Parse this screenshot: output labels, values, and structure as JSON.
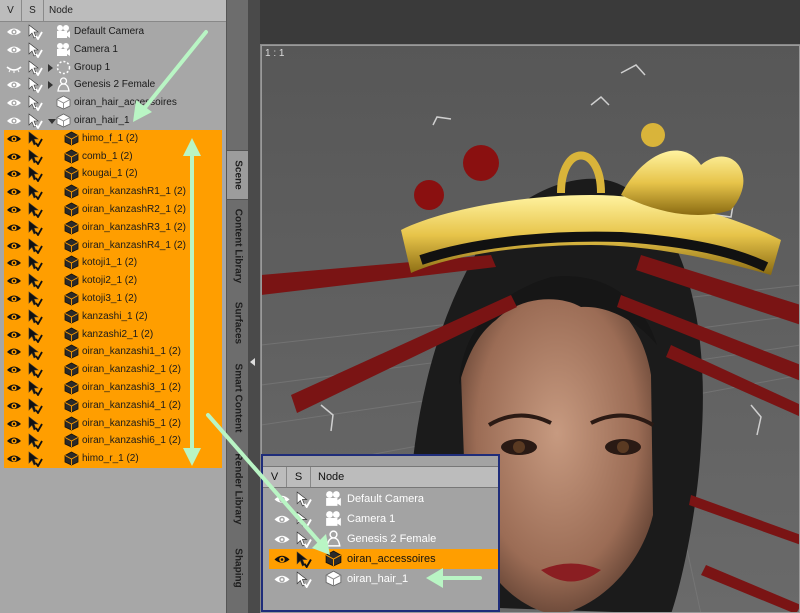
{
  "scene": {
    "columns": {
      "v": "V",
      "s": "S",
      "node": "Node"
    },
    "rows": [
      {
        "label": "Default Camera",
        "icon": "camera-icon",
        "indent": 0,
        "expand": "none",
        "visible": true,
        "selected": false
      },
      {
        "label": "Camera 1",
        "icon": "camera-icon",
        "indent": 0,
        "expand": "none",
        "visible": true,
        "selected": false
      },
      {
        "label": "Group 1",
        "icon": "group-icon",
        "indent": 0,
        "expand": "closed",
        "visible": false,
        "selected": false
      },
      {
        "label": "Genesis 2 Female",
        "icon": "figure-icon",
        "indent": 0,
        "expand": "closed",
        "visible": true,
        "selected": false
      },
      {
        "label": "oiran_hair_accessoires",
        "icon": "prop-icon",
        "indent": 0,
        "expand": "none",
        "visible": true,
        "selected": false
      },
      {
        "label": "oiran_hair_1",
        "icon": "prop-icon",
        "indent": 0,
        "expand": "open",
        "visible": true,
        "selected": false
      },
      {
        "label": "himo_f_1 (2)",
        "icon": "prop-icon",
        "indent": 1,
        "expand": "none",
        "visible": true,
        "selected": true
      },
      {
        "label": "comb_1 (2)",
        "icon": "prop-icon",
        "indent": 1,
        "expand": "none",
        "visible": true,
        "selected": true
      },
      {
        "label": "kougai_1 (2)",
        "icon": "prop-icon",
        "indent": 1,
        "expand": "none",
        "visible": true,
        "selected": true
      },
      {
        "label": "oiran_kanzashR1_1 (2)",
        "icon": "prop-icon",
        "indent": 1,
        "expand": "none",
        "visible": true,
        "selected": true
      },
      {
        "label": "oiran_kanzashR2_1 (2)",
        "icon": "prop-icon",
        "indent": 1,
        "expand": "none",
        "visible": true,
        "selected": true
      },
      {
        "label": "oiran_kanzashR3_1 (2)",
        "icon": "prop-icon",
        "indent": 1,
        "expand": "none",
        "visible": true,
        "selected": true
      },
      {
        "label": "oiran_kanzashR4_1 (2)",
        "icon": "prop-icon",
        "indent": 1,
        "expand": "none",
        "visible": true,
        "selected": true
      },
      {
        "label": "kotoji1_1 (2)",
        "icon": "prop-icon",
        "indent": 1,
        "expand": "none",
        "visible": true,
        "selected": true
      },
      {
        "label": "kotoji2_1 (2)",
        "icon": "prop-icon",
        "indent": 1,
        "expand": "none",
        "visible": true,
        "selected": true
      },
      {
        "label": "kotoji3_1 (2)",
        "icon": "prop-icon",
        "indent": 1,
        "expand": "none",
        "visible": true,
        "selected": true
      },
      {
        "label": "kanzashi_1 (2)",
        "icon": "prop-icon",
        "indent": 1,
        "expand": "none",
        "visible": true,
        "selected": true
      },
      {
        "label": "kanzashi2_1 (2)",
        "icon": "prop-icon",
        "indent": 1,
        "expand": "none",
        "visible": true,
        "selected": true
      },
      {
        "label": "oiran_kanzashi1_1 (2)",
        "icon": "prop-icon",
        "indent": 1,
        "expand": "none",
        "visible": true,
        "selected": true
      },
      {
        "label": "oiran_kanzashi2_1 (2)",
        "icon": "prop-icon",
        "indent": 1,
        "expand": "none",
        "visible": true,
        "selected": true
      },
      {
        "label": "oiran_kanzashi3_1 (2)",
        "icon": "prop-icon",
        "indent": 1,
        "expand": "none",
        "visible": true,
        "selected": true
      },
      {
        "label": "oiran_kanzashi4_1 (2)",
        "icon": "prop-icon",
        "indent": 1,
        "expand": "none",
        "visible": true,
        "selected": true
      },
      {
        "label": "oiran_kanzashi5_1 (2)",
        "icon": "prop-icon",
        "indent": 1,
        "expand": "none",
        "visible": true,
        "selected": true
      },
      {
        "label": "oiran_kanzashi6_1 (2)",
        "icon": "prop-icon",
        "indent": 1,
        "expand": "none",
        "visible": true,
        "selected": true
      },
      {
        "label": "himo_r_1 (2)",
        "icon": "prop-icon",
        "indent": 1,
        "expand": "none",
        "visible": true,
        "selected": true
      }
    ]
  },
  "tabs": [
    "Scene",
    "Content Library",
    "Surfaces",
    "Smart Content",
    "Render Library",
    "Shaping"
  ],
  "viewport": {
    "ratio_label": "1 : 1"
  },
  "inset": {
    "columns": {
      "v": "V",
      "s": "S",
      "node": "Node"
    },
    "rows": [
      {
        "label": "Default Camera",
        "icon": "camera-icon",
        "selected": false
      },
      {
        "label": "Camera 1",
        "icon": "camera-icon",
        "selected": false
      },
      {
        "label": "Genesis 2 Female",
        "icon": "figure-icon",
        "selected": false
      },
      {
        "label": "oiran_accessoires",
        "icon": "prop-icon",
        "selected": true
      },
      {
        "label": "oiran_hair_1",
        "icon": "prop-icon",
        "selected": false
      }
    ]
  },
  "colors": {
    "selection": "#ff9e00",
    "panel": "#a7a7a7",
    "annotation_arrow": "#b9f5c4",
    "inset_border": "#1f2d7a"
  }
}
